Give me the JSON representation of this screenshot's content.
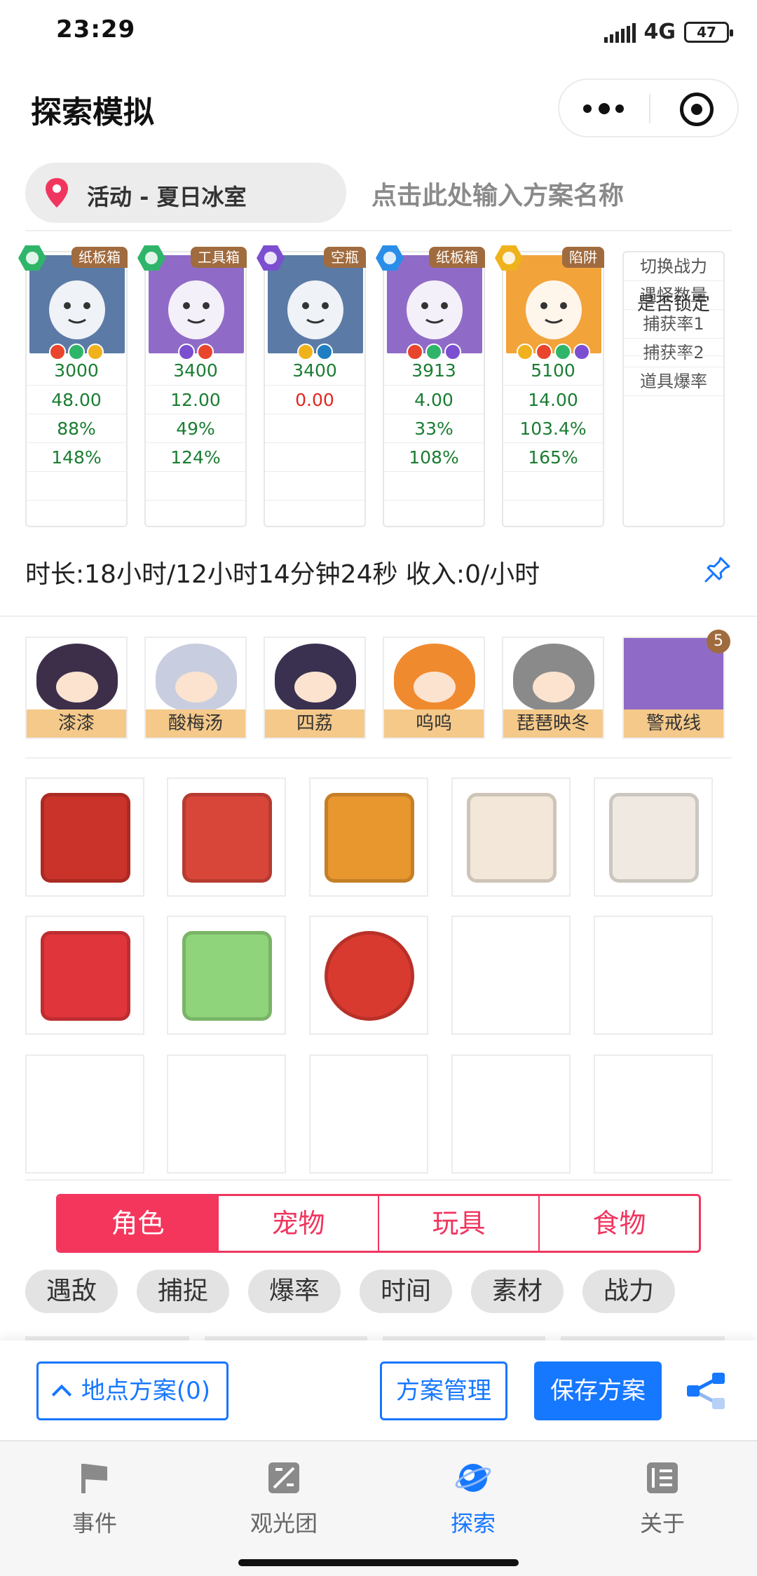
{
  "status": {
    "time": "23:29",
    "network": "4G",
    "battery": "47"
  },
  "header": {
    "title": "探索模拟"
  },
  "location": {
    "label": "活动 - 夏日冰室",
    "plan_placeholder": "点击此处输入方案名称"
  },
  "cards": [
    {
      "tag": "纸板箱",
      "hex_color": "#2fb56a",
      "bg": "#5b7aa6",
      "chips": [
        "#e8452c",
        "#2fb56a",
        "#f0b21c"
      ],
      "stats": [
        "3000",
        "48.00",
        "88%",
        "148%",
        "",
        ""
      ]
    },
    {
      "tag": "工具箱",
      "hex_color": "#2fb56a",
      "bg": "#8f6bc7",
      "chips": [
        "#7b4fd0",
        "#e8452c"
      ],
      "stats": [
        "3400",
        "12.00",
        "49%",
        "124%",
        "",
        ""
      ]
    },
    {
      "tag": "空瓶",
      "hex_color": "#7b4fd0",
      "bg": "#5b7aa6",
      "chips": [
        "#f0b21c",
        "#1f7fc2"
      ],
      "stats": [
        "3400",
        "0.00",
        "",
        "",
        "",
        ""
      ]
    },
    {
      "tag": "纸板箱",
      "hex_color": "#2a8ee8",
      "bg": "#8f6bc7",
      "chips": [
        "#e8452c",
        "#2fb56a",
        "#7b4fd0"
      ],
      "stats": [
        "3913",
        "4.00",
        "33%",
        "108%",
        "",
        ""
      ]
    },
    {
      "tag": "陷阱",
      "hex_color": "#f0b21c",
      "bg": "#f2a33a",
      "chips": [
        "#f0b21c",
        "#e8452c",
        "#2fb56a",
        "#7b4fd0"
      ],
      "stats": [
        "5100",
        "14.00",
        "103.4%",
        "165%",
        "",
        ""
      ]
    }
  ],
  "labels": {
    "lock": "是否锁定",
    "rows": [
      "切换战力",
      "遇怪数量",
      "捕获率1",
      "捕获率2",
      "道具爆率"
    ]
  },
  "summary": "时长:18小时/12小时14分钟24秒 收入:0/小时",
  "members": [
    {
      "name": "漆漆",
      "color": "#3d2f4a"
    },
    {
      "name": "酸梅汤",
      "color": "#c9cde0"
    },
    {
      "name": "四荔",
      "color": "#3a3050"
    },
    {
      "name": "呜呜",
      "color": "#f08a2e"
    },
    {
      "name": "琵琶映冬",
      "color": "#8a8a8a"
    },
    {
      "name": "警戒线",
      "color": "#8f6bc7",
      "badge": "5"
    }
  ],
  "items": [
    {
      "name": "food-box-icon",
      "color": "#c9332a"
    },
    {
      "name": "fried-chicken-bucket-icon",
      "color": "#d8463a"
    },
    {
      "name": "flashlight-icon",
      "color": "#e8962e"
    },
    {
      "name": "clapperboard-icon",
      "color": "#f2e7d8"
    },
    {
      "name": "envelope-icon",
      "color": "#efe9e2"
    },
    {
      "name": "red-wallet-icon",
      "color": "#e0353a"
    },
    {
      "name": "melon-umbrella-icon",
      "color": "#8fd47a"
    },
    {
      "name": "alarm-clock-icon",
      "color": "#d93a30"
    }
  ],
  "tabs": [
    {
      "label": "角色",
      "active": true
    },
    {
      "label": "宠物",
      "active": false
    },
    {
      "label": "玩具",
      "active": false
    },
    {
      "label": "食物",
      "active": false
    }
  ],
  "filters": [
    "遇敌",
    "捕捉",
    "爆率",
    "时间",
    "素材",
    "战力"
  ],
  "actions": {
    "location_plans": "地点方案(0)",
    "manage": "方案管理",
    "save": "保存方案"
  },
  "nav": [
    {
      "label": "事件",
      "icon": "flag-icon",
      "active": false
    },
    {
      "label": "观光团",
      "icon": "ruler-icon",
      "active": false
    },
    {
      "label": "探索",
      "icon": "planet-icon",
      "active": true
    },
    {
      "label": "关于",
      "icon": "list-icon",
      "active": false
    }
  ]
}
